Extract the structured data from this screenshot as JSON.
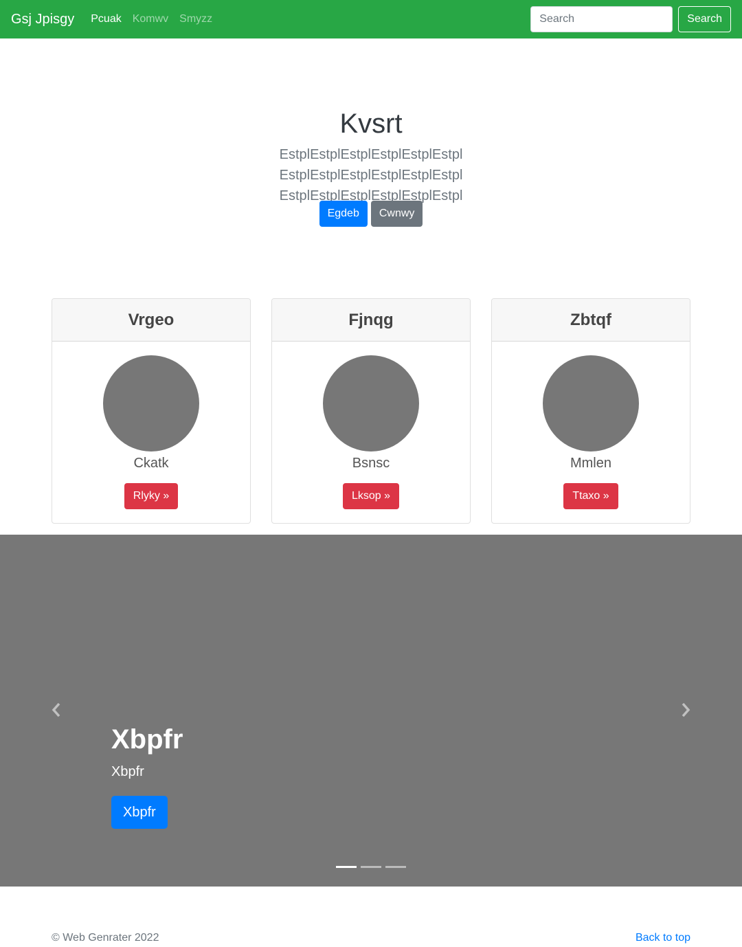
{
  "navbar": {
    "brand": "Gsj Jpisgy",
    "links": [
      "Pcuak",
      "Komwv",
      "Smyzz"
    ],
    "search_placeholder": "Search",
    "search_button": "Search",
    "color": "#28a745"
  },
  "hero": {
    "title": "Kvsrt",
    "lead": "EstplEstplEstplEstplEstplEstpl EstplEstplEstplEstplEstplEstpl EstplEstplEstplEstplEstplEstpl",
    "primary_button": "Egdeb",
    "secondary_button": "Cwnwy"
  },
  "cards": [
    {
      "title": "Vrgeo",
      "name": "Ckatk",
      "button": "Rlyky »"
    },
    {
      "title": "Fjnqg",
      "name": "Bsnsc",
      "button": "Lksop »"
    },
    {
      "title": "Zbtqf",
      "name": "Mmlen",
      "button": "Ttaxo »"
    }
  ],
  "carousel": {
    "heading": "Xbpfr",
    "subheading": "Xbpfr",
    "button": "Xbpfr",
    "prev_icon": "chevron-left-icon",
    "next_icon": "chevron-right-icon",
    "active_slide": 1,
    "slide_count": 3
  },
  "footer": {
    "copyright": "© Web Genrater 2022",
    "back_to_top": "Back to top"
  },
  "colors": {
    "primary": "#007bff",
    "secondary": "#6c757d",
    "danger": "#dc3545",
    "placeholder_gray": "#777777"
  }
}
